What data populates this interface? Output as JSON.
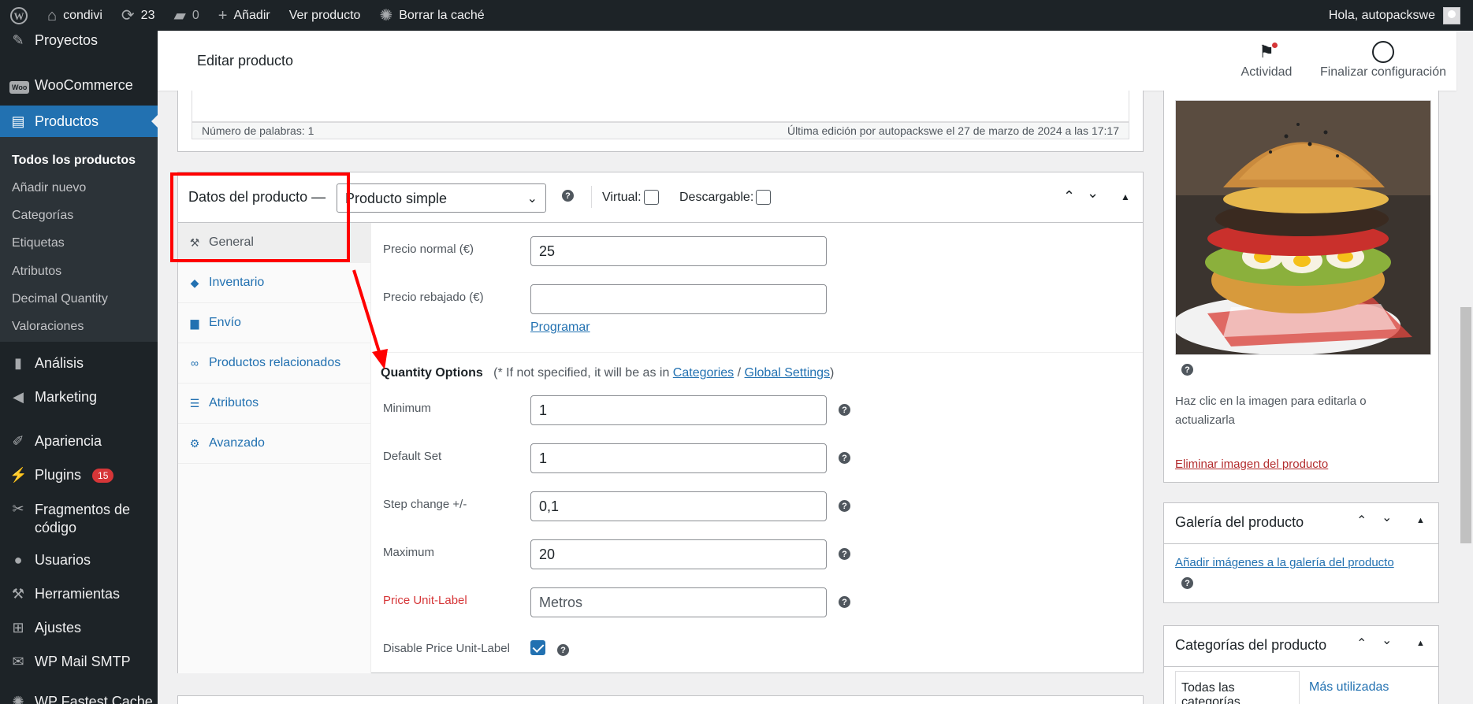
{
  "adminbar": {
    "site_name": "condivi",
    "updates_count": "23",
    "comments_count": "0",
    "add_label": "Añadir",
    "view_product": "Ver producto",
    "clear_cache": "Borrar la caché",
    "greeting": "Hola, autopackswe"
  },
  "sidebar": {
    "items": [
      {
        "label": "Proyectos",
        "icon": "pin-icon"
      },
      {
        "label": "WooCommerce",
        "icon": "woo-icon"
      },
      {
        "label": "Productos",
        "icon": "archive-icon"
      },
      {
        "label": "Análisis",
        "icon": "chart-icon"
      },
      {
        "label": "Marketing",
        "icon": "megaphone-icon"
      },
      {
        "label": "Apariencia",
        "icon": "brush-icon"
      },
      {
        "label": "Plugins",
        "icon": "plugin-icon",
        "badge": "15"
      },
      {
        "label": "Fragmentos de código",
        "icon": "scissors-icon"
      },
      {
        "label": "Usuarios",
        "icon": "user-icon"
      },
      {
        "label": "Herramientas",
        "icon": "wrench-icon"
      },
      {
        "label": "Ajustes",
        "icon": "sliders-icon"
      },
      {
        "label": "WP Mail SMTP",
        "icon": "mail-icon"
      },
      {
        "label": "WP Fastest Cache",
        "icon": "cache-icon"
      }
    ],
    "woo_icon_text": "Woo",
    "submenu": [
      "Todos los productos",
      "Añadir nuevo",
      "Categorías",
      "Etiquetas",
      "Atributos",
      "Decimal Quantity",
      "Valoraciones"
    ]
  },
  "header": {
    "title": "Editar producto",
    "activity": "Actividad",
    "finish_setup": "Finalizar configuración"
  },
  "editor": {
    "word_count": "Número de palabras: 1",
    "last_edit": "Última edición por autopackswe el 27 de marzo de 2024 a las 17:17"
  },
  "product_data": {
    "title": "Datos del producto —",
    "type": "Producto simple",
    "virtual_label": "Virtual:",
    "downloadable_label": "Descargable:",
    "tabs": [
      "General",
      "Inventario",
      "Envío",
      "Productos relacionados",
      "Atributos",
      "Avanzado"
    ],
    "regular_price_label": "Precio normal (€)",
    "regular_price_value": "25",
    "sale_price_label": "Precio rebajado (€)",
    "sale_price_value": "",
    "schedule_link": "Programar",
    "quantity_heading": "Quantity Options",
    "quantity_note_prefix": "(* If not specified, it will be as in",
    "quantity_note_categories": "Categories",
    "quantity_note_sep": "/",
    "quantity_note_global": "Global Settings",
    "quantity_note_suffix": ")",
    "minimum_label": "Minimum",
    "minimum_value": "1",
    "default_label": "Default Set",
    "default_value": "1",
    "step_label": "Step change +/-",
    "step_value": "0,1",
    "maximum_label": "Maximum",
    "maximum_value": "20",
    "unit_label": "Price Unit-Label",
    "unit_value": "Metros",
    "disable_unit_label": "Disable Price Unit-Label",
    "disable_unit_checked": true
  },
  "image_box": {
    "hint": "Haz clic en la imagen para editarla o actualizarla",
    "remove": "Eliminar imagen del producto"
  },
  "gallery_box": {
    "title": "Galería del producto",
    "add_link": "Añadir imágenes a la galería del producto"
  },
  "categories_box": {
    "title": "Categorías del producto",
    "tab_all": "Todas las categorías",
    "tab_popular": "Más utilizadas"
  },
  "colors": {
    "admin_dark": "#1d2327",
    "accent_blue": "#2271b1",
    "annotation_red": "#ff0000"
  }
}
